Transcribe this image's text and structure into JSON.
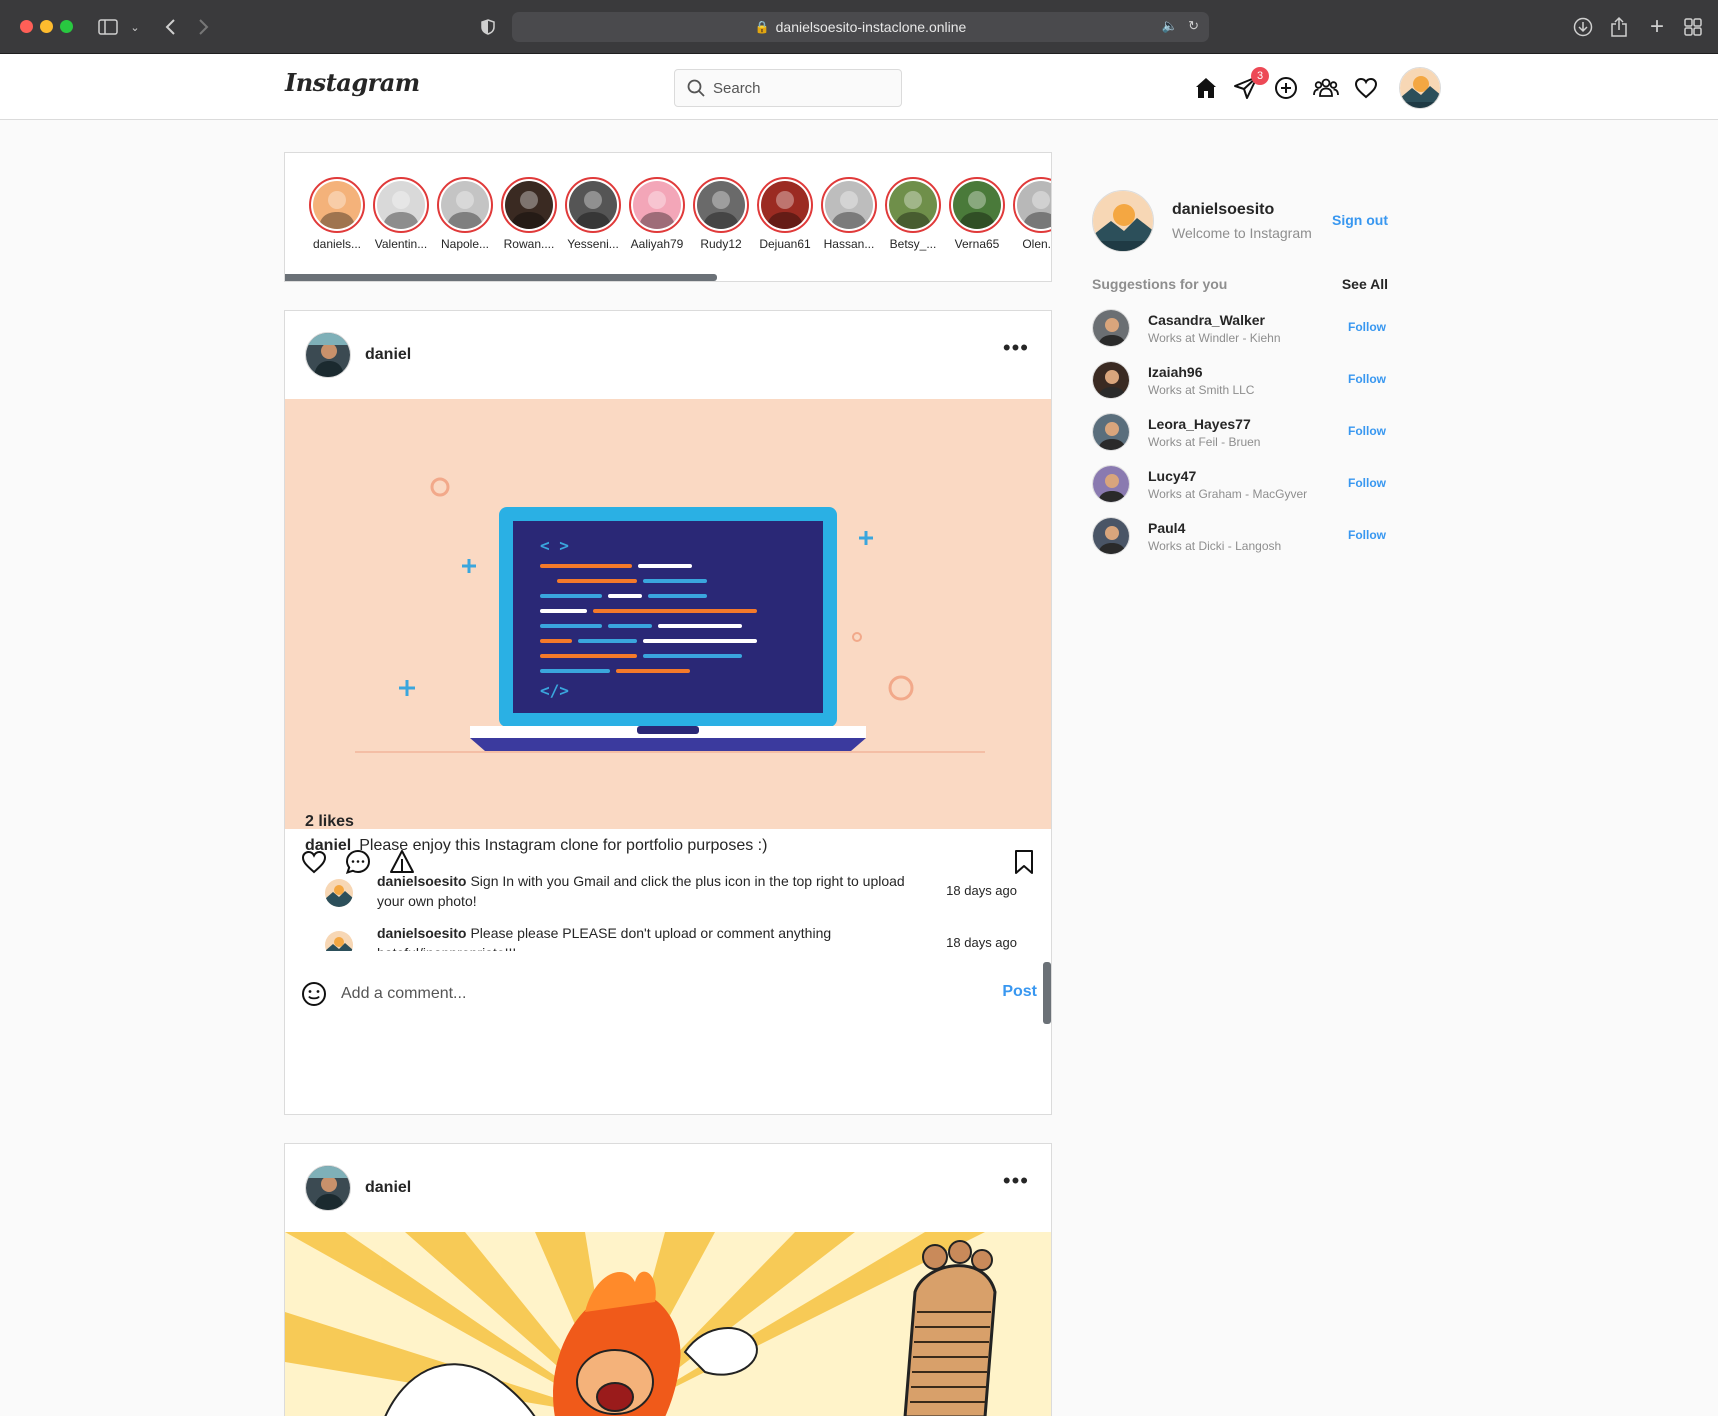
{
  "browser": {
    "url": "danielsoesito-instaclone.online"
  },
  "header": {
    "logo": "Instagram",
    "search_placeholder": "Search",
    "messages_badge": "3"
  },
  "stories": [
    {
      "name": "daniels...",
      "color": "#f4b27a"
    },
    {
      "name": "Valentin...",
      "color": "#d9d9d9"
    },
    {
      "name": "Napole...",
      "color": "#c4c4c4"
    },
    {
      "name": "Rowan....",
      "color": "#3a2a22"
    },
    {
      "name": "Yesseni...",
      "color": "#555555"
    },
    {
      "name": "Aaliyah79",
      "color": "#f3a6b8"
    },
    {
      "name": "Rudy12",
      "color": "#6a6a6a"
    },
    {
      "name": "Dejuan61",
      "color": "#9b2b22"
    },
    {
      "name": "Hassan...",
      "color": "#bdbdbd"
    },
    {
      "name": "Betsy_...",
      "color": "#6f8f4a"
    },
    {
      "name": "Verna65",
      "color": "#4a7a3a"
    },
    {
      "name": "Olen.C",
      "color": "#b8b8b8"
    }
  ],
  "posts": [
    {
      "user": "daniel",
      "likes": "2 likes",
      "caption_user": "daniel",
      "caption": "Please enjoy this Instagram clone for portfolio purposes :)",
      "comments": [
        {
          "user": "danielsoesito",
          "text": "Sign In with you Gmail and click the plus icon in the top right to upload your own photo!",
          "time": "18 days ago"
        },
        {
          "user": "danielsoesito",
          "text": "Please please PLEASE don't upload or comment anything hateful/inappropriate!!!",
          "time": "18 days ago"
        }
      ],
      "comment_placeholder": "Add a comment...",
      "post_label": "Post"
    },
    {
      "user": "daniel"
    }
  ],
  "sidebar": {
    "username": "danielsoesito",
    "welcome": "Welcome to Instagram",
    "signout": "Sign out",
    "suggestions_title": "Suggestions for you",
    "see_all": "See All",
    "suggestions": [
      {
        "name": "Casandra_Walker",
        "work": "Works at Windler - Kiehn",
        "follow": "Follow"
      },
      {
        "name": "Izaiah96",
        "work": "Works at Smith LLC",
        "follow": "Follow"
      },
      {
        "name": "Leora_Hayes77",
        "work": "Works at Feil - Bruen",
        "follow": "Follow"
      },
      {
        "name": "Lucy47",
        "work": "Works at Graham - MacGyver",
        "follow": "Follow"
      },
      {
        "name": "Paul4",
        "work": "Works at Dicki - Langosh",
        "follow": "Follow"
      }
    ]
  },
  "colors": {
    "accent": "#3897f0",
    "story_ring": "#e03a3a",
    "badge": "#ed4956"
  }
}
